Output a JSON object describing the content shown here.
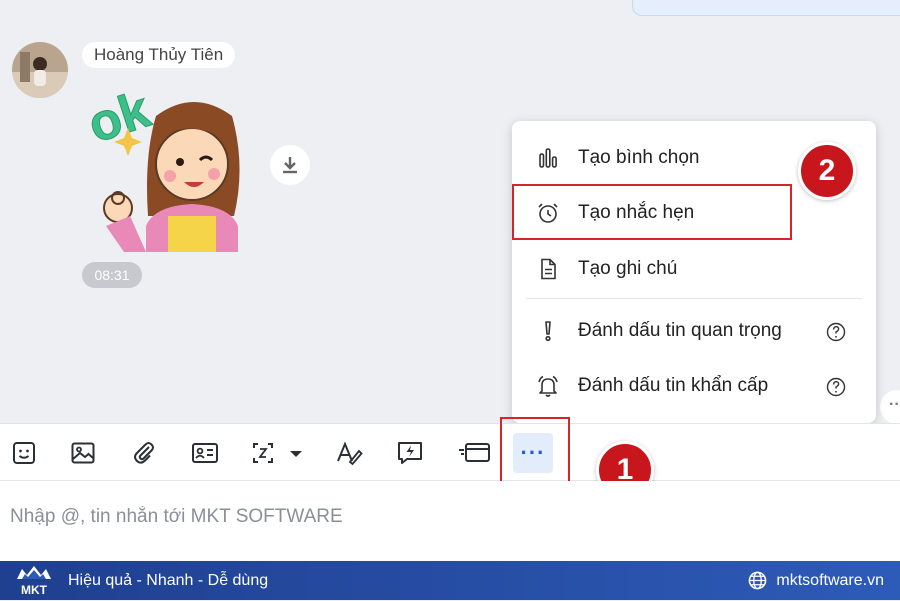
{
  "chat": {
    "sender_name": "Hoàng Thủy Tiên",
    "sticker_text": "ok",
    "message_time": "08:31"
  },
  "menu": {
    "items": [
      {
        "label": "Tạo bình chọn",
        "icon": "poll-chart-icon"
      },
      {
        "label": "Tạo nhắc hẹn",
        "icon": "alarm-clock-icon"
      },
      {
        "label": "Tạo ghi chú",
        "icon": "note-document-icon"
      },
      {
        "label": "Đánh dấu tin quan trọng",
        "icon": "exclamation-icon",
        "help": true
      },
      {
        "label": "Đánh dấu tin khẩn cấp",
        "icon": "bell-icon",
        "help": true
      }
    ]
  },
  "annotations": {
    "step1": "1",
    "step2": "2",
    "highlight_color": "#d8232a",
    "badge_color": "#c8161d"
  },
  "toolbar": {
    "buttons": [
      "sticker-icon",
      "image-icon",
      "attachment-icon",
      "contact-card-icon",
      "screenshot-icon",
      "text-format-icon",
      "quick-message-icon",
      "payment-card-icon",
      "more-options-icon"
    ],
    "more_label": "···"
  },
  "composer": {
    "placeholder": "Nhập @, tin nhắn tới MKT SOFTWARE"
  },
  "footer": {
    "brand": "MKT",
    "tagline": "Hiệu quả - Nhanh - Dễ dùng",
    "website": "mktsoftware.vn",
    "gradient_start": "#1f3f8f",
    "gradient_end": "#2d5bb8"
  }
}
